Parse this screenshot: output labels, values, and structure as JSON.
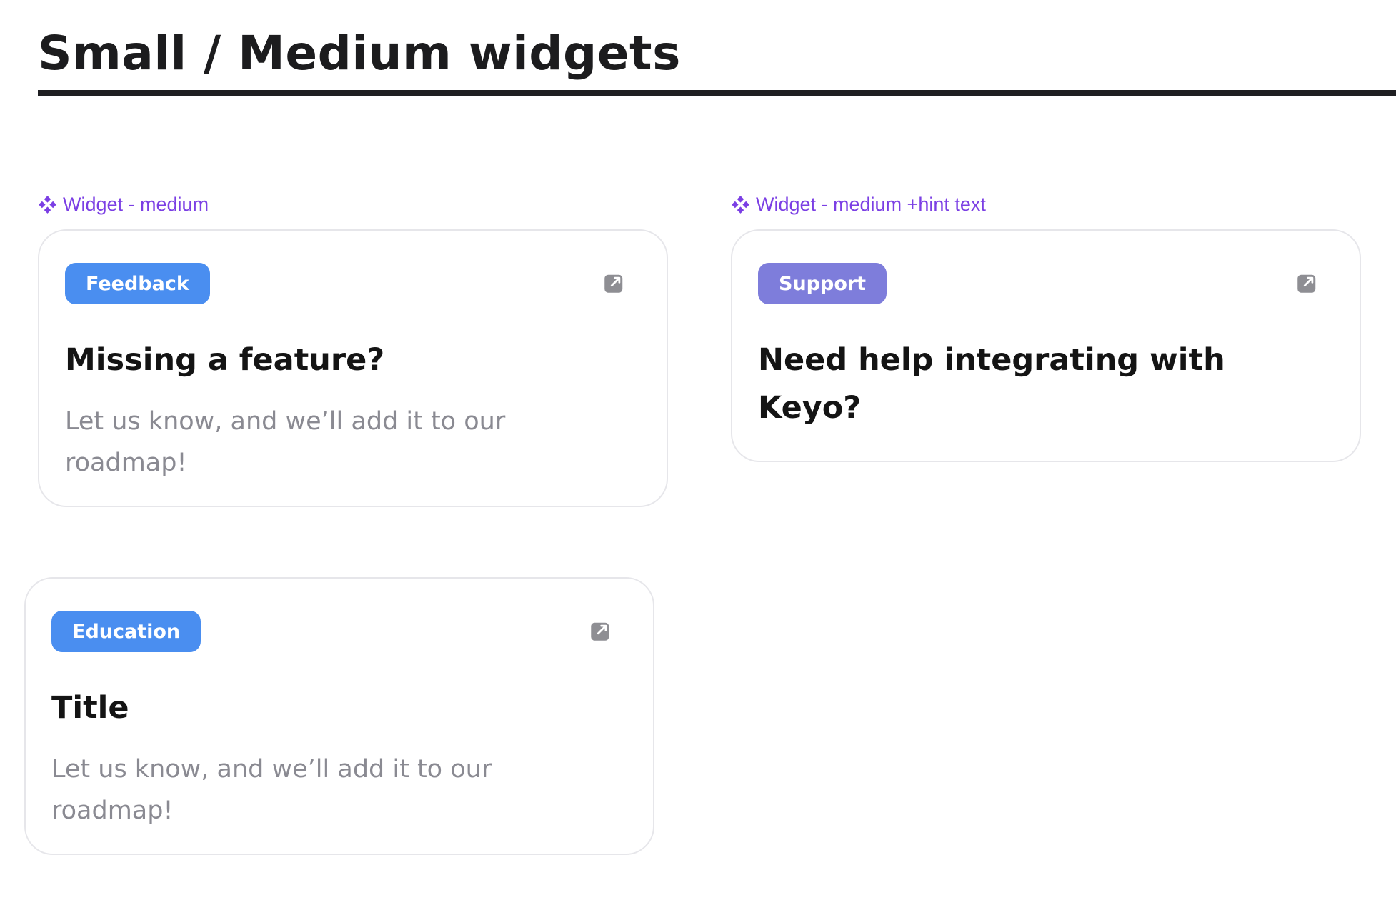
{
  "header": {
    "title": "Small / Medium widgets"
  },
  "sections": [
    {
      "component_label": "Widget - medium",
      "component_icon": "component-diamond-icon",
      "card": {
        "tag": "Feedback",
        "tag_color": "#4a8ef0",
        "title": "Missing a feature?",
        "description": "Let us know, and we’ll add it to our roadmap!",
        "action_icon": "external-link-icon"
      }
    },
    {
      "component_label": "Widget - medium +hint text",
      "component_icon": "component-diamond-icon",
      "card": {
        "tag": "Support",
        "tag_color": "#7e7ddb",
        "title": "Need help integrating with Keyo?",
        "action_icon": "external-link-icon"
      }
    },
    {
      "card": {
        "tag": "Education",
        "tag_color": "#4a8ef0",
        "title": "Title",
        "description": "Let us know, and we’ll add it to our roadmap!",
        "action_icon": "external-link-icon"
      }
    }
  ],
  "colors": {
    "component_label": "#7b3fe4",
    "card_border": "#e6e6ea",
    "description_text": "#8a8a92",
    "icon_gray": "#8e8e93"
  }
}
